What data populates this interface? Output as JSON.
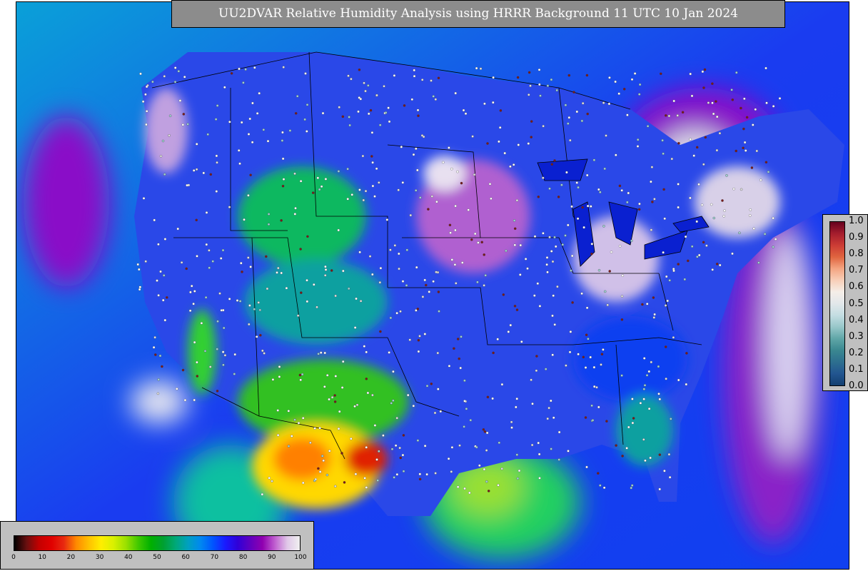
{
  "title": "UU2DVAR Relative Humidity Analysis using HRRR Background 11 UTC 10 Jan 2024",
  "right_colorbar": {
    "ticks": [
      "1.0",
      "0.9",
      "0.8",
      "0.7",
      "0.6",
      "0.5",
      "0.4",
      "0.3",
      "0.2",
      "0.1",
      "0.0"
    ],
    "colors": [
      "#67001f",
      "#a51d2d",
      "#cc3c35",
      "#e0653f",
      "#f4a582",
      "#f8cfb8",
      "#f5eee8",
      "#e2e7ea",
      "#c3dde2",
      "#97c7c9",
      "#5fa6a7",
      "#3a8790",
      "#2d6f8f",
      "#225590",
      "#123f70"
    ]
  },
  "bottom_colorbar": {
    "ticks": [
      "0",
      "10",
      "20",
      "30",
      "40",
      "50",
      "60",
      "70",
      "80",
      "90",
      "100"
    ],
    "colors": [
      "#000000",
      "#6a0f0f",
      "#c40000",
      "#e00000",
      "#e82a10",
      "#ff8a00",
      "#ffc000",
      "#ffee00",
      "#d8f000",
      "#9ae000",
      "#40c800",
      "#00b000",
      "#00a030",
      "#00a878",
      "#00a0c0",
      "#0088f0",
      "#0055ff",
      "#1a1aff",
      "#3000d8",
      "#6000c0",
      "#9000b0",
      "#c060d0",
      "#e0c8e8",
      "#f0f0f0"
    ]
  },
  "map": {
    "ocean_color": "#1a3cf0",
    "land_color": "#2b52e0"
  }
}
